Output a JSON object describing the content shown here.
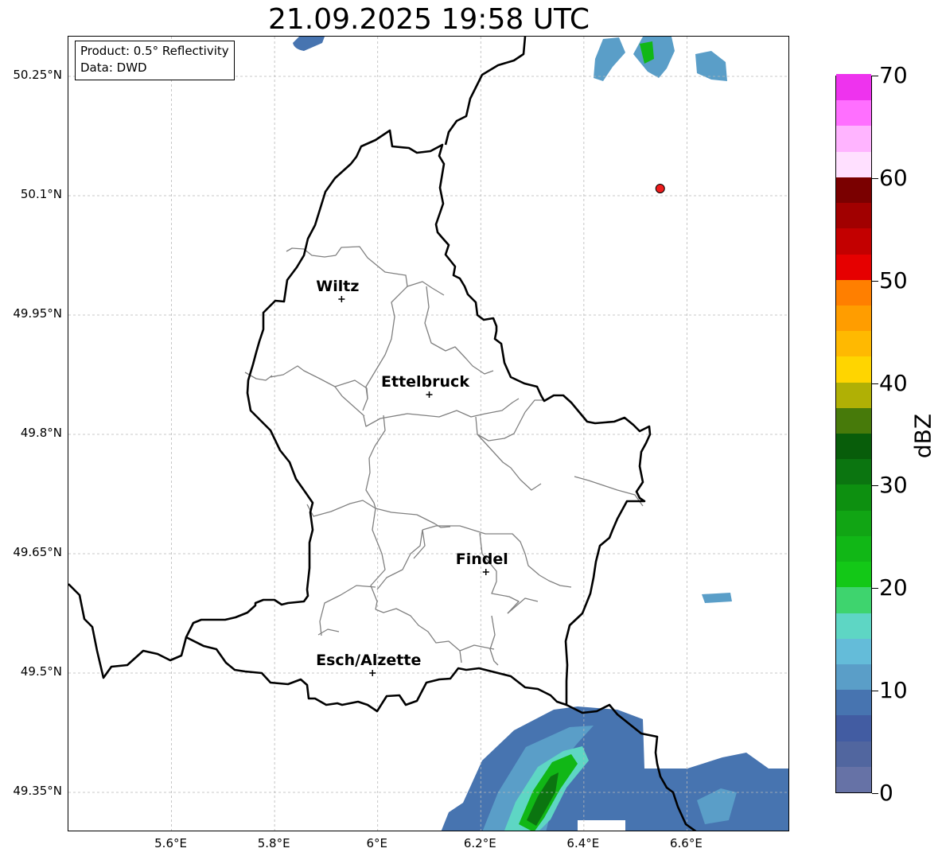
{
  "title": "21.09.2025 19:58 UTC",
  "info": {
    "product": "Product: 0.5° Reflectivity",
    "data": "Data: DWD"
  },
  "extent": {
    "lon_min": 5.4,
    "lon_max": 6.8,
    "lat_min": 49.3,
    "lat_max": 50.3
  },
  "lat_ticks": [
    {
      "value": 50.25,
      "label": "50.25°N"
    },
    {
      "value": 50.1,
      "label": "50.1°N"
    },
    {
      "value": 49.95,
      "label": "49.95°N"
    },
    {
      "value": 49.8,
      "label": "49.8°N"
    },
    {
      "value": 49.65,
      "label": "49.65°N"
    },
    {
      "value": 49.5,
      "label": "49.5°N"
    },
    {
      "value": 49.35,
      "label": "49.35°N"
    }
  ],
  "lon_ticks": [
    {
      "value": 5.6,
      "label": "5.6°E"
    },
    {
      "value": 5.8,
      "label": "5.8°E"
    },
    {
      "value": 6.0,
      "label": "6°E"
    },
    {
      "value": 6.2,
      "label": "6.2°E"
    },
    {
      "value": 6.4,
      "label": "6.4°E"
    },
    {
      "value": 6.6,
      "label": "6.6°E"
    }
  ],
  "cities": [
    {
      "name": "Wiltz",
      "lon": 5.93,
      "lat": 49.97
    },
    {
      "name": "Ettelbruck",
      "lon": 6.1,
      "lat": 49.85
    },
    {
      "name": "Findel",
      "lon": 6.21,
      "lat": 49.627
    },
    {
      "name": "Esch/Alzette",
      "lon": 5.99,
      "lat": 49.5
    }
  ],
  "radar_site": {
    "lon": 6.548,
    "lat": 50.109,
    "color": "#ee1c1c"
  },
  "colorbar": {
    "unit": "dBZ",
    "min": 0,
    "max": 70,
    "step": 2.5,
    "tick_values": [
      0,
      10,
      20,
      30,
      40,
      50,
      60,
      70
    ],
    "tick_labels": [
      "0",
      "10",
      "20",
      "30",
      "40",
      "50",
      "60",
      "70"
    ],
    "colors": [
      "#6672a6",
      "#51669f",
      "#425ca2",
      "#4774b0",
      "#5a9ec8",
      "#64bcd9",
      "#5ed6c4",
      "#3ed46e",
      "#13c817",
      "#11b716",
      "#11a514",
      "#0d9010",
      "#0b7510",
      "#085d0a",
      "#477a0a",
      "#b0b005",
      "#ffd500",
      "#ffb901",
      "#ff9d00",
      "#ff7f00",
      "#e60000",
      "#c30000",
      "#a10000",
      "#7a0000",
      "#ffe0ff",
      "#ffb4ff",
      "#ff6fff",
      "#ee33ee"
    ]
  },
  "colors": {
    "border": "#000000",
    "canton": "#808080",
    "grid": "#b8b8b8"
  }
}
